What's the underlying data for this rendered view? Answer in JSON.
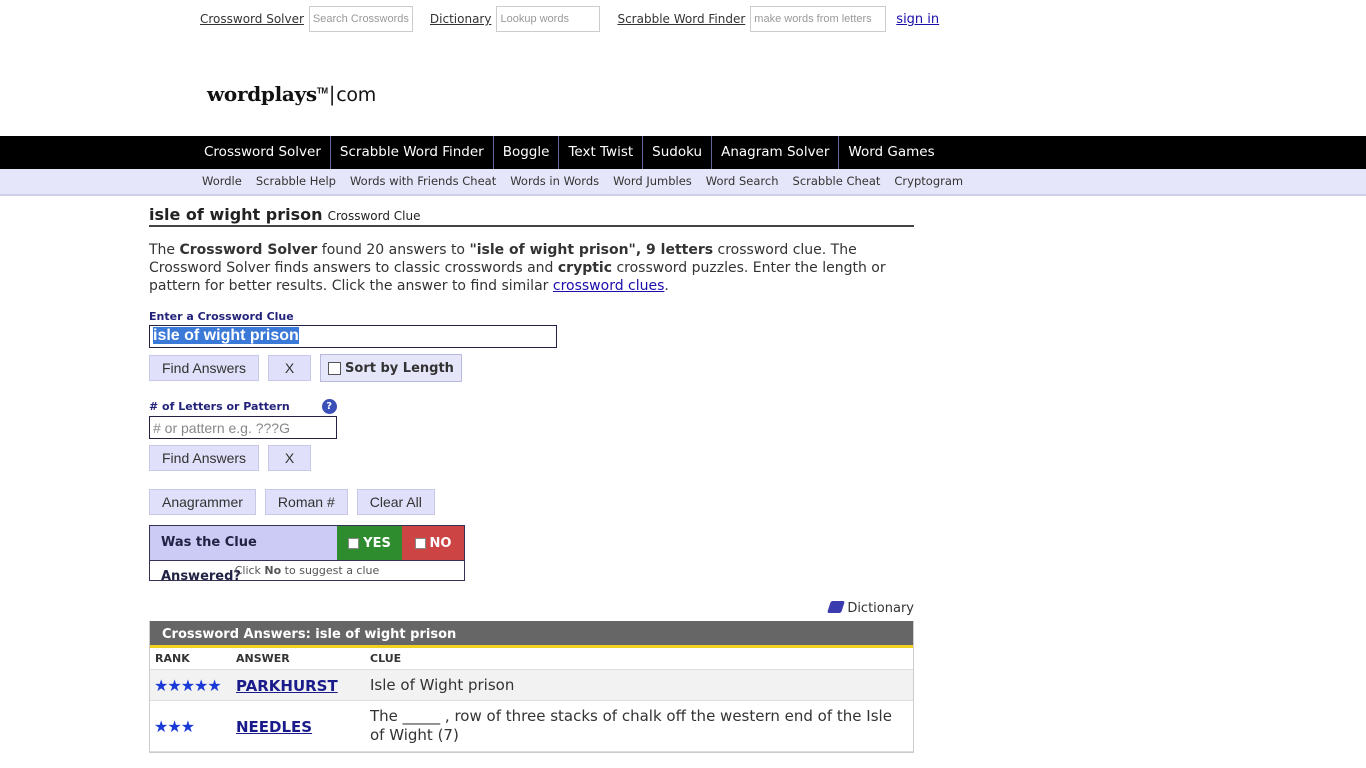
{
  "topbar": {
    "crossword_solver_link": "Crossword Solver",
    "crossword_search_placeholder": "Search Crosswords",
    "dictionary_link": "Dictionary",
    "dictionary_placeholder": "Lookup words",
    "scrabble_link": "Scrabble Word Finder",
    "scrabble_placeholder": "make words from letters",
    "signin": "sign in"
  },
  "logo": {
    "name": "wordplays",
    "tm": "TM",
    "separator": "|",
    "tld": "com"
  },
  "main_nav": [
    "Crossword Solver",
    "Scrabble Word Finder",
    "Boggle",
    "Text Twist",
    "Sudoku",
    "Anagram Solver",
    "Word Games"
  ],
  "sub_nav": [
    "Wordle",
    "Scrabble Help",
    "Words with Friends Cheat",
    "Words in Words",
    "Word Jumbles",
    "Word Search",
    "Scrabble Cheat",
    "Cryptogram"
  ],
  "page": {
    "title": "isle of wight prison",
    "subtitle": "Crossword Clue",
    "intro": {
      "p1": "The ",
      "b1": "Crossword Solver",
      "p2": " found 20 answers to ",
      "b2": "\"isle of wight prison\", 9 letters",
      "p3": " crossword clue. The Crossword Solver finds answers to classic crosswords and ",
      "b3": "cryptic",
      "p4": " crossword puzzles. Enter the length or pattern for better results. Click the answer to find similar ",
      "link": "crossword clues",
      "p5": "."
    }
  },
  "clue_form": {
    "label": "Enter a Crossword Clue",
    "value": "isle of wight prison",
    "find_button": "Find Answers",
    "clear_button": "X",
    "sort_label": "Sort by Length"
  },
  "pattern_form": {
    "label": "# of Letters or Pattern",
    "help": "?",
    "placeholder": "# or pattern e.g. ???G",
    "find_button": "Find Answers",
    "clear_button": "X"
  },
  "tools": [
    "Anagrammer",
    "Roman #",
    "Clear All"
  ],
  "answered": {
    "question": "Was the Clue Answered?",
    "yes": "YES",
    "no": "NO",
    "hint_pre": "Click ",
    "hint_bold": "No",
    "hint_post": " to suggest a clue"
  },
  "dictionary_link": "Dictionary",
  "answers": {
    "header": "Crossword Answers: isle of wight prison",
    "columns": [
      "RANK",
      "ANSWER",
      "CLUE"
    ],
    "rows": [
      {
        "rank": 5,
        "stars": "★★★★★",
        "answer": "PARKHURST",
        "clue": "Isle of Wight prison"
      },
      {
        "rank": 3,
        "stars": "★★★",
        "answer": "NEEDLES",
        "clue": "The _____ , row of three stacks of chalk off the western end of the Isle of Wight (7)"
      }
    ]
  }
}
